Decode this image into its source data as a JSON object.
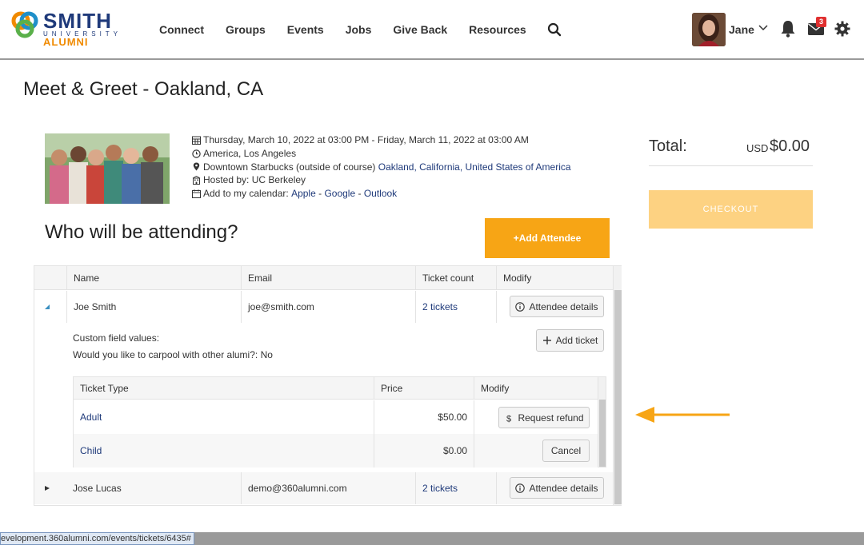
{
  "brand": {
    "name": "SMITH",
    "sub": "UNIVERSITY",
    "alumni": "ALUMNI",
    "color_primary": "#1f3a7a",
    "color_accent": "#f08a00"
  },
  "nav": [
    "Connect",
    "Groups",
    "Events",
    "Jobs",
    "Give Back",
    "Resources"
  ],
  "user": {
    "name": "Jane",
    "mail_count": "3"
  },
  "page": {
    "title": "Meet & Greet - Oakland, CA"
  },
  "event": {
    "datetime": "Thursday, March 10, 2022 at 03:00 PM - Friday, March 11, 2022 at 03:00 AM",
    "timezone": "America, Los Angeles",
    "location_prefix": "Downtown Starbucks (outside of course)",
    "location_link": "Oakland, California, United States of America",
    "hosted_by": "Hosted by: UC Berkeley",
    "calendar_label": "Add to my calendar:",
    "calendar_apple": "Apple",
    "calendar_google": "Google",
    "calendar_outlook": "Outlook",
    "sep": " - "
  },
  "attending": {
    "heading": "Who will be attending?",
    "add_button": "+Add Attendee"
  },
  "summary": {
    "total_label": "Total:",
    "currency": "USD",
    "total": "$0.00",
    "checkout": "CHECKOUT"
  },
  "attendees_table": {
    "headers": [
      "Name",
      "Email",
      "Ticket count",
      "Modify"
    ],
    "rows": [
      {
        "name": "Joe Smith",
        "email": "joe@smith.com",
        "tickets": "2 tickets",
        "action": "Attendee details"
      },
      {
        "name": "Jose Lucas",
        "email": "demo@360alumni.com",
        "tickets": "2 tickets",
        "action": "Attendee details"
      }
    ],
    "custom_title": "Custom field values:",
    "custom_value": "Would you like to carpool with other alumi?: No",
    "add_ticket": "Add ticket"
  },
  "tickets_table": {
    "headers": [
      "Ticket Type",
      "Price",
      "Modify"
    ],
    "rows": [
      {
        "type": "Adult",
        "price": "$50.00",
        "action": "Request refund"
      },
      {
        "type": "Child",
        "price": "$0.00",
        "action": "Cancel"
      }
    ]
  },
  "status_url": "evelopment.360alumni.com/events/tickets/6435#"
}
